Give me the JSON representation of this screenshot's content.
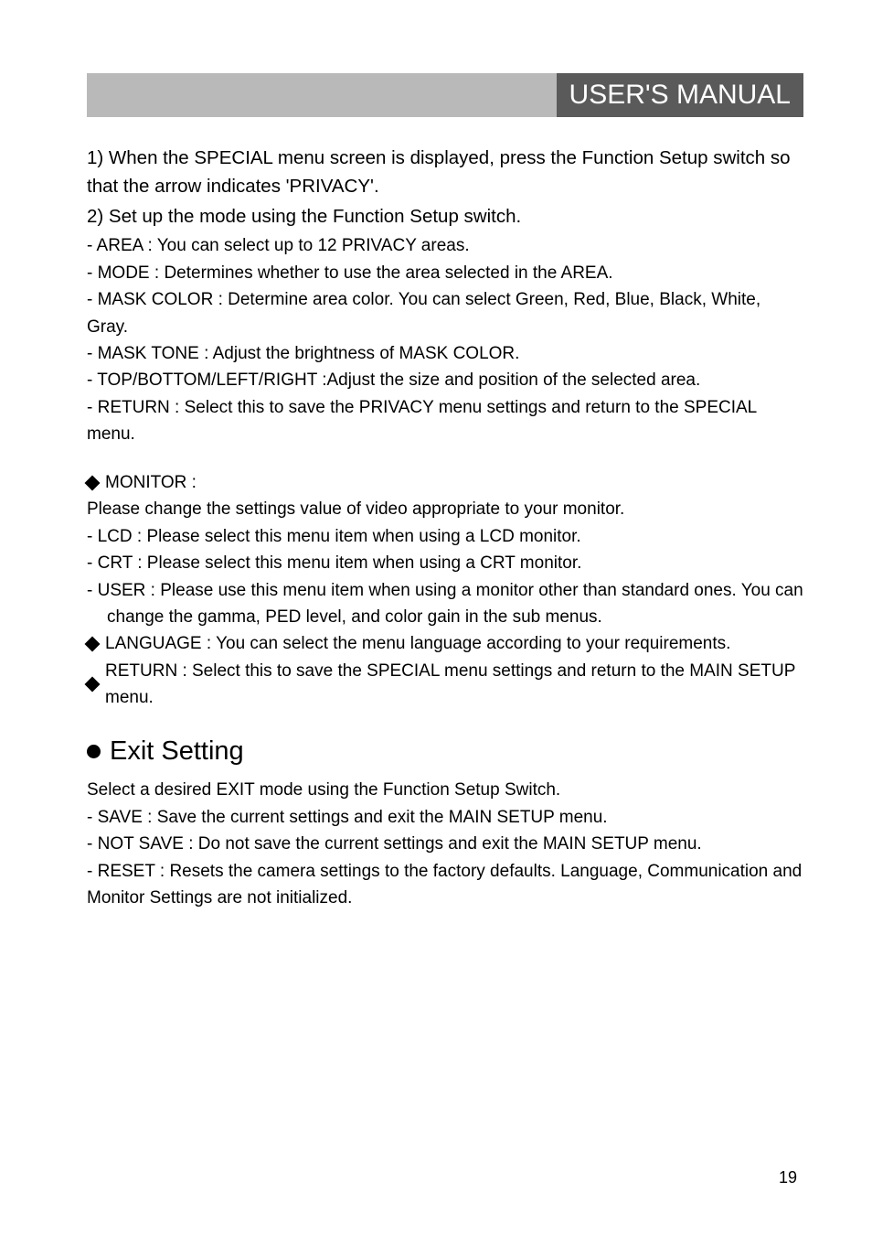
{
  "header": {
    "title": "USER'S MANUAL"
  },
  "privacy": {
    "step1": "1) When the SPECIAL menu screen is displayed, press the Function Setup switch so that the arrow indicates 'PRIVACY'.",
    "step2": "2) Set up the mode using the Function Setup switch.",
    "area": "- AREA : You can select up to 12 PRIVACY areas.",
    "mode": "- MODE : Determines whether to use the area selected in the AREA.",
    "maskColor": "- MASK COLOR : Determine area color. You can select Green, Red, Blue, Black, White, Gray.",
    "maskTone": "- MASK TONE : Adjust the brightness of MASK COLOR.",
    "tblr": "- TOP/BOTTOM/LEFT/RIGHT :Adjust the size and position of the selected area.",
    "return": "- RETURN : Select this to save the PRIVACY menu settings and return to the SPECIAL menu."
  },
  "monitor": {
    "heading": "MONITOR :",
    "intro": "Please change the settings value of video appropriate to your monitor.",
    "lcd": " - LCD : Please select this menu item when using a LCD monitor.",
    "crt": " - CRT : Please select this menu item when using a CRT monitor.",
    "user1": " - USER : Please use this menu item when using a monitor other than standard ones. You can",
    "user2": "change the gamma, PED level, and color gain in the sub menus.",
    "language": "LANGUAGE : You can select the menu language according to your requirements.",
    "return": "RETURN : Select this to save the SPECIAL menu settings and return to the MAIN SETUP menu."
  },
  "exit": {
    "heading": "Exit Setting",
    "intro": "Select a desired EXIT mode using the Function Setup Switch.",
    "save": "- SAVE : Save the current settings and exit the MAIN SETUP menu.",
    "notSave": "- NOT SAVE : Do not save the current settings and exit the MAIN SETUP menu.",
    "reset": "- RESET : Resets the camera settings to the factory defaults. Language, Communication and Monitor Settings are not initialized."
  },
  "pageNumber": "19"
}
